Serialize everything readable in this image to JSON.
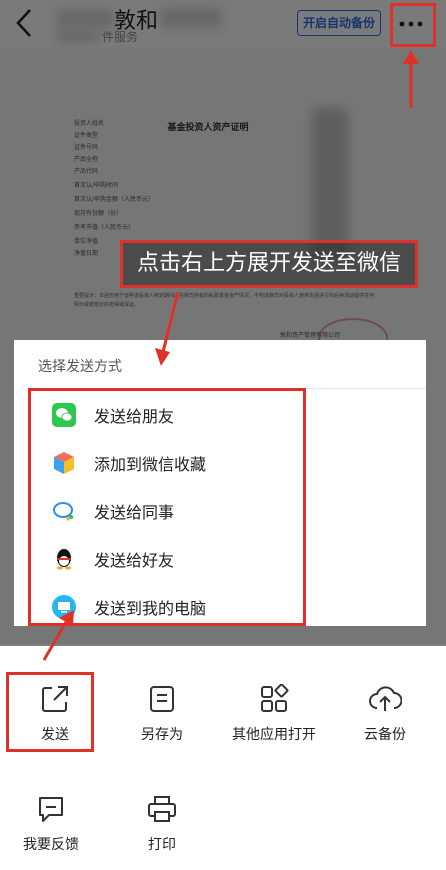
{
  "header": {
    "title": "敦和",
    "subtitle": "件服务",
    "backup_button": "开启自动备份"
  },
  "document": {
    "title": "基金投资人资产证明",
    "fields": [
      "投资人姓名",
      "证件类型",
      "证件号码",
      "产品全称",
      "产品代码",
      "首次认/申购时间",
      "首次认/申购金额（人民币元）",
      "现持有份额（份）",
      "参考市值（人民币元）",
      "单位净值",
      "净值日期"
    ],
    "note": "重要提示：本函仅用于证明该投资人特定期间内在我司持有的私募基金资产情况，不构成我司对投资人使用本函进行的后续活动提供任何明示或者暗示的担保或保证。",
    "signature": "敦和资产管理有限公司"
  },
  "annotation": {
    "banner": "点击右上方展开发送至微信"
  },
  "share_sheet": {
    "heading": "选择发送方式",
    "items": [
      {
        "label": "发送给朋友",
        "icon": "wechat-icon",
        "color": "#2dc84d"
      },
      {
        "label": "添加到微信收藏",
        "icon": "wechat-favorites-icon",
        "color": "#f5a623"
      },
      {
        "label": "发送给同事",
        "icon": "wecom-icon",
        "color": "#2b8ff0"
      },
      {
        "label": "发送给好友",
        "icon": "qq-icon",
        "color": "#111111"
      },
      {
        "label": "发送到我的电脑",
        "icon": "computer-icon",
        "color": "#2bb5ee"
      }
    ]
  },
  "actions": {
    "send": "发送",
    "save_as": "另存为",
    "open_other": "其他应用打开",
    "cloud_backup": "云备份",
    "feedback": "我要反馈",
    "print": "打印"
  },
  "colors": {
    "accent": "#2f6bd8",
    "annotation": "#e0302a"
  }
}
